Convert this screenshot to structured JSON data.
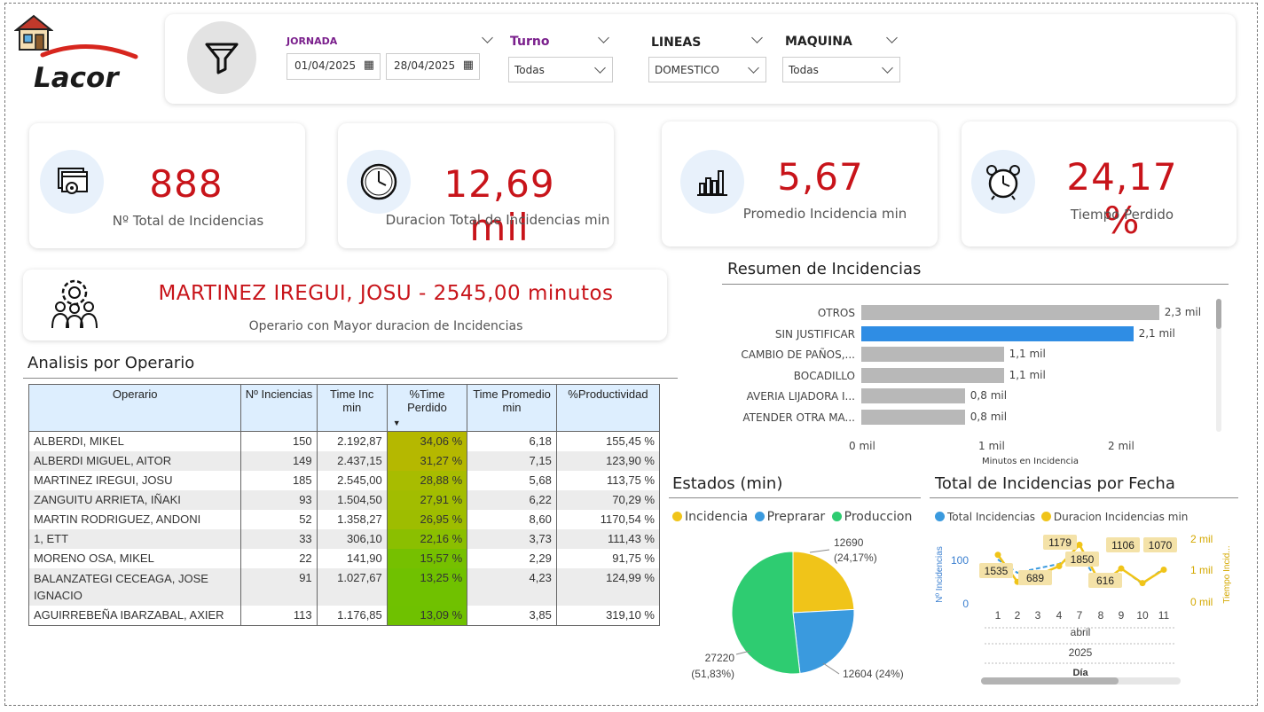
{
  "header": {
    "jornada_label": "JORNADA",
    "date_from": "01/04/2025",
    "date_to": "28/04/2025",
    "turno_label": "Turno",
    "turno_value": "Todas",
    "lineas_label": "LINEAS",
    "lineas_value": "DOMESTICO",
    "maquina_label": "MAQUINA",
    "maquina_value": "Todas",
    "logo_text": "Lacor"
  },
  "kpis": [
    {
      "value": "888",
      "label": "Nº Total de Incidencias"
    },
    {
      "value": "12,69 mil",
      "label": "Duracion Total de Incidencias min"
    },
    {
      "value": "5,67",
      "label": "Promedio Incidencia min"
    },
    {
      "value": "24,17 %",
      "label": "Tiempo Perdido"
    }
  ],
  "top_operator": {
    "headline": "MARTINEZ IREGUI, JOSU - 2545,00 minutos",
    "caption": "Operario con Mayor duracion de Incidencias"
  },
  "table": {
    "title": "Analisis por Operario",
    "headers": [
      "Operario",
      "Nº Inciencias",
      "Time Inc min",
      "%Time Perdido",
      "Time Promedio min",
      "%Productividad"
    ],
    "rows": [
      [
        "ALBERDI, MIKEL",
        "150",
        "2.192,87",
        "34,06 %",
        "6,18",
        "155,45 %"
      ],
      [
        "ALBERDI MIGUEL, AITOR",
        "149",
        "2.437,15",
        "31,27 %",
        "7,15",
        "123,90 %"
      ],
      [
        "MARTINEZ IREGUI, JOSU",
        "185",
        "2.545,00",
        "28,88 %",
        "5,68",
        "113,75 %"
      ],
      [
        "ZANGUITU ARRIETA, IÑAKI",
        "93",
        "1.504,50",
        "27,91 %",
        "6,22",
        "70,29 %"
      ],
      [
        "MARTIN RODRIGUEZ, ANDONI",
        "52",
        "1.358,27",
        "26,95 %",
        "8,60",
        "1170,54 %"
      ],
      [
        "1, ETT",
        "33",
        "306,10",
        "22,16 %",
        "3,73",
        "111,43 %"
      ],
      [
        "MORENO OSA, MIKEL",
        "22",
        "141,90",
        "15,57 %",
        "2,29",
        "91,75 %"
      ],
      [
        "BALANZATEGI CECEAGA, JOSE IGNACIO",
        "91",
        "1.027,67",
        "13,25 %",
        "4,23",
        "124,99 %"
      ],
      [
        "AGUIRREBEÑA IBARZABAL, AXIER",
        "113",
        "1.176,85",
        "13,09 %",
        "3,85",
        "319,10 %"
      ]
    ],
    "cell_colors": [
      "#b5b800",
      "#b5b800",
      "#a8bc00",
      "#a2bd00",
      "#9ebd00",
      "#8bbf00",
      "#76c000",
      "#70c100",
      "#6fc100"
    ]
  },
  "resumen": {
    "title": "Resumen de Incidencias",
    "xlabel": "Minutos en Incidencia",
    "ticks": [
      "0 mil",
      "1 mil",
      "2 mil"
    ],
    "bar_color": "#b8b8b8",
    "highlight_color": "#2f8de4"
  },
  "estados": {
    "title": "Estados (min)",
    "legend": [
      "Incidencia",
      "Preprarar",
      "Produccion"
    ],
    "colors": [
      "#f0c419",
      "#3a9ade",
      "#2ecc71"
    ],
    "labels": [
      "12690",
      "(24,17%)",
      "12604 (24%)",
      "27220",
      "(51,83%)"
    ]
  },
  "fecha": {
    "title": "Total de Incidencias por Fecha",
    "legend": [
      "Total Incidencias",
      "Duracion Incidencias min"
    ],
    "colors": [
      "#3a9ade",
      "#f0c419"
    ],
    "y_left_title": "Nº Incidencias",
    "y_right_title": "Tiempo Incid...",
    "y_left_ticks": [
      "100",
      "0"
    ],
    "y_right_ticks": [
      "2 mil",
      "1 mil",
      "0 mil"
    ],
    "month": "abril",
    "year": "2025",
    "xlabel": "Día",
    "data_labels": [
      "1535",
      "689",
      "1179",
      "1850",
      "616",
      "1106",
      "1070"
    ]
  },
  "chart_data": [
    {
      "type": "bar",
      "title": "Resumen de Incidencias",
      "xlabel": "Minutos en Incidencia",
      "categories": [
        "OTROS",
        "SIN JUSTIFICAR",
        "CAMBIO DE PAÑOS,...",
        "BOCADILLO",
        "AVERIA LIJADORA I...",
        "ATENDER OTRA MA..."
      ],
      "values": [
        2.3,
        2.1,
        1.1,
        1.1,
        0.8,
        0.8
      ],
      "value_labels": [
        "2,3 mil",
        "2,1 mil",
        "1,1 mil",
        "1,1 mil",
        "0,8 mil",
        "0,8 mil"
      ],
      "xlim": [
        0,
        2.5
      ]
    },
    {
      "type": "pie",
      "title": "Estados (min)",
      "categories": [
        "Incidencia",
        "Preprarar",
        "Produccion"
      ],
      "values": [
        12690,
        12604,
        27220
      ]
    },
    {
      "type": "line",
      "title": "Total de Incidencias por Fecha",
      "x": [
        "1",
        "2",
        "3",
        "4",
        "7",
        "8",
        "9",
        "10",
        "11"
      ],
      "series": [
        {
          "name": "Total Incidencias",
          "values": [
            100,
            70,
            80,
            90,
            115,
            40,
            80,
            45,
            80
          ]
        },
        {
          "name": "Duracion Incidencias min",
          "values": [
            1535,
            689,
            900,
            1179,
            1850,
            616,
            1106,
            650,
            1070
          ]
        }
      ],
      "ylim_left": [
        0,
        150
      ],
      "ylim_right": [
        0,
        2000
      ]
    }
  ]
}
